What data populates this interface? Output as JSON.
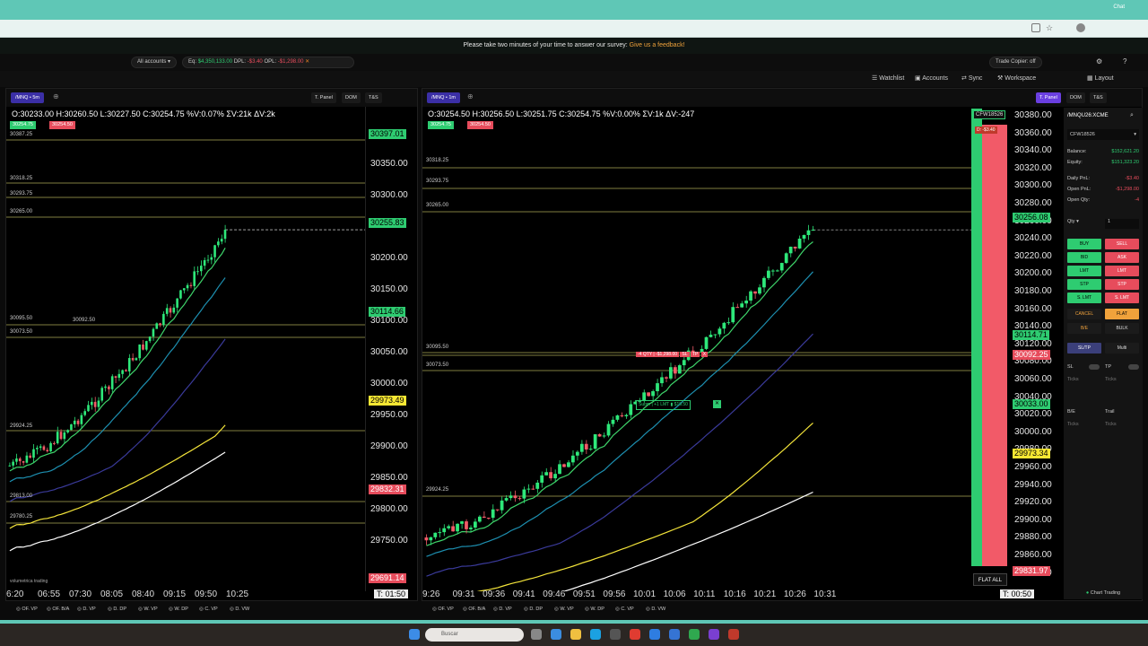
{
  "survey": {
    "text": "Please take two minutes of your time to answer our survey:",
    "link": "Give us a feedback!"
  },
  "account_bar": {
    "accounts": "All accounts",
    "eq_label": "Eq:",
    "eq_value": "$4,350,133.00",
    "dpl_label": "DPL:",
    "dpl_value": "-$3.40",
    "opl_label": "OPL:",
    "opl_value": "-$1,298.00",
    "trade_copier": "Trade Copier: off"
  },
  "menu": {
    "watchlist": "Watchlist",
    "accounts": "Accounts",
    "sync": "Sync",
    "workspace": "Workspace",
    "layout": "Layout"
  },
  "left_chart": {
    "symbol": "/MNQ",
    "timeframe": "5m",
    "buttons": [
      "T. Panel",
      "DOM",
      "T&S"
    ],
    "ohlc": "O:30233.00  H:30260.50  L:30227.50  C:30254.75  %V:0.07%  ΣV:21k  ΔV:2k",
    "bid_tag": "30254.75",
    "ask_tag": "30254.50",
    "levels": [
      "30387.25",
      "30318.25",
      "30293.75",
      "30265.00",
      "30095.50",
      "30092.50",
      "30073.50",
      "29924.25",
      "29813.00",
      "29780.25"
    ],
    "price_axis": [
      "30350.00",
      "30300.00",
      "30200.00",
      "30150.00",
      "30100.00",
      "30050.00",
      "30000.00",
      "29950.00",
      "29900.00",
      "29850.00",
      "29800.00",
      "29750.00"
    ],
    "box_tags": {
      "top": "30397.01",
      "last": "30255.83",
      "mid": "30114.66",
      "yellow": "29973.49",
      "red": "29832.31",
      "bottom": "29691.14"
    },
    "time_axis": [
      "6:20",
      "06:55",
      "07:30",
      "08:05",
      "08:40",
      "09:15",
      "09:50",
      "10:25"
    ],
    "timer": "T: 01:50",
    "logo": "volumetrica trading"
  },
  "right_chart": {
    "symbol": "/MNQ",
    "timeframe": "1m",
    "buttons": [
      "T. Panel",
      "DOM",
      "T&S"
    ],
    "ohlc": "O:30254.50  H:30256.50  L:30251.75  C:30254.75  %V:0.00%  ΣV:1k  ΔV:-247",
    "bid_tag": "30254.75",
    "ask_tag": "30254.50",
    "levels": [
      "30318.25",
      "30293.75",
      "30265.00",
      "30095.50",
      "30073.50",
      "29924.25"
    ],
    "price_axis": [
      "30380.00",
      "30360.00",
      "30340.00",
      "30320.00",
      "30300.00",
      "30280.00",
      "30260.00",
      "30240.00",
      "30220.00",
      "30200.00",
      "30180.00",
      "30160.00",
      "30140.00",
      "30120.00",
      "30080.00",
      "30060.00",
      "30040.00",
      "30020.00",
      "30000.00",
      "29980.00",
      "29960.00",
      "29940.00",
      "29920.00",
      "29900.00",
      "29880.00",
      "29860.00",
      "29840.00"
    ],
    "box_tags": {
      "last": "30256.08",
      "mid": "30114.71",
      "red_mid": "30092.25",
      "green": "30033.00",
      "yellow": "29973.34",
      "red": "29831.97"
    },
    "order_tag": {
      "qty": "-4 QTY | -$1,298.00",
      "sl": "SL",
      "tp": "TP",
      "x": "X"
    },
    "submit_tag": "Subm | +1 LMT",
    "submit_price": "$19.50",
    "account_tag": "CFW18526",
    "pnl_tag": "D: -$3.40",
    "flat_all": "FLAT ALL",
    "time_axis": [
      "9:26",
      "09:31",
      "09:36",
      "09:41",
      "09:46",
      "09:51",
      "09:56",
      "10:01",
      "10:06",
      "10:11",
      "10:16",
      "10:21",
      "10:26",
      "10:31"
    ],
    "timer": "T: 00:50"
  },
  "trade_panel": {
    "symbol": "/MNQU26:XCME",
    "account": "CFW18526",
    "balance_label": "Balance:",
    "balance": "$152,621.20",
    "equity_label": "Equity:",
    "equity": "$151,323.20",
    "daily_pnl_label": "Daily PnL:",
    "daily_pnl": "-$3.40",
    "open_pnl_label": "Open PnL:",
    "open_pnl": "-$1,298.00",
    "open_qty_label": "Open Qty:",
    "open_qty": "-4",
    "qty_label": "Qty",
    "qty_value": "1",
    "buttons": [
      [
        "BUY",
        "SELL"
      ],
      [
        "BID",
        "ASK"
      ],
      [
        "LMT",
        "LMT"
      ],
      [
        "STP",
        "STP"
      ],
      [
        "S. LMT",
        "S. LMT"
      ]
    ],
    "cancel": "CANCEL",
    "flat": "FLAT",
    "be": "B/E",
    "bulk": "BULK",
    "sltp": "SL/TP",
    "multi": "Multi",
    "sl": "SL",
    "tp": "TP",
    "ticks": "Ticks",
    "be_short": "B/E",
    "trail": "Trail",
    "chart_trading": "Chart Trading"
  },
  "bottom_tabs": [
    "OF. VP",
    "OF. B/A",
    "D. VP",
    "D. DP",
    "W. VP",
    "W. DP",
    "C. VP",
    "D. VW"
  ],
  "taskbar": {
    "search": "Buscar"
  }
}
